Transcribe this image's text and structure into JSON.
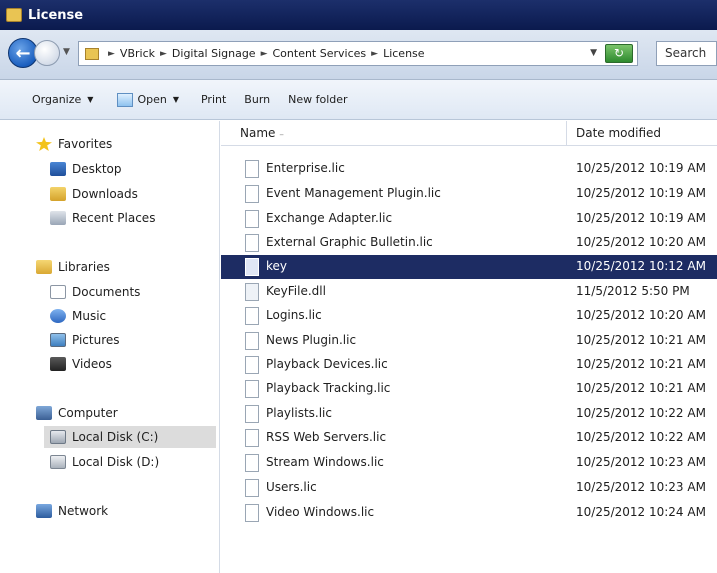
{
  "window": {
    "title": "License"
  },
  "address": {
    "breadcrumbs": [
      "VBrick",
      "Digital Signage",
      "Content Services",
      "License"
    ],
    "search_placeholder": "Search"
  },
  "toolbar": {
    "organize": "Organize",
    "open": "Open",
    "print": "Print",
    "burn": "Burn",
    "new_folder": "New folder"
  },
  "nav": {
    "favorites": "Favorites",
    "desktop": "Desktop",
    "downloads": "Downloads",
    "recent_places": "Recent Places",
    "libraries": "Libraries",
    "documents": "Documents",
    "music": "Music",
    "pictures": "Pictures",
    "videos": "Videos",
    "computer": "Computer",
    "local_disk_c": "Local Disk (C:)",
    "local_disk_d": "Local Disk (D:)",
    "network": "Network"
  },
  "columns": {
    "name": "Name",
    "date_modified": "Date modified"
  },
  "files": [
    {
      "name": "Enterprise.lic",
      "date": "10/25/2012 10:19 AM",
      "type": "lic"
    },
    {
      "name": "Event Management Plugin.lic",
      "date": "10/25/2012 10:19 AM",
      "type": "lic"
    },
    {
      "name": "Exchange Adapter.lic",
      "date": "10/25/2012 10:19 AM",
      "type": "lic"
    },
    {
      "name": "External Graphic Bulletin.lic",
      "date": "10/25/2012 10:20 AM",
      "type": "lic"
    },
    {
      "name": "key",
      "date": "10/25/2012 10:12 AM",
      "type": "key",
      "selected": true
    },
    {
      "name": "KeyFile.dll",
      "date": "11/5/2012 5:50 PM",
      "type": "dll"
    },
    {
      "name": "Logins.lic",
      "date": "10/25/2012 10:20 AM",
      "type": "lic"
    },
    {
      "name": "News Plugin.lic",
      "date": "10/25/2012 10:21 AM",
      "type": "lic"
    },
    {
      "name": "Playback Devices.lic",
      "date": "10/25/2012 10:21 AM",
      "type": "lic"
    },
    {
      "name": "Playback Tracking.lic",
      "date": "10/25/2012 10:21 AM",
      "type": "lic"
    },
    {
      "name": "Playlists.lic",
      "date": "10/25/2012 10:22 AM",
      "type": "lic"
    },
    {
      "name": "RSS Web Servers.lic",
      "date": "10/25/2012 10:22 AM",
      "type": "lic"
    },
    {
      "name": "Stream Windows.lic",
      "date": "10/25/2012 10:23 AM",
      "type": "lic"
    },
    {
      "name": "Users.lic",
      "date": "10/25/2012 10:23 AM",
      "type": "lic"
    },
    {
      "name": "Video Windows.lic",
      "date": "10/25/2012 10:24 AM",
      "type": "lic"
    }
  ]
}
